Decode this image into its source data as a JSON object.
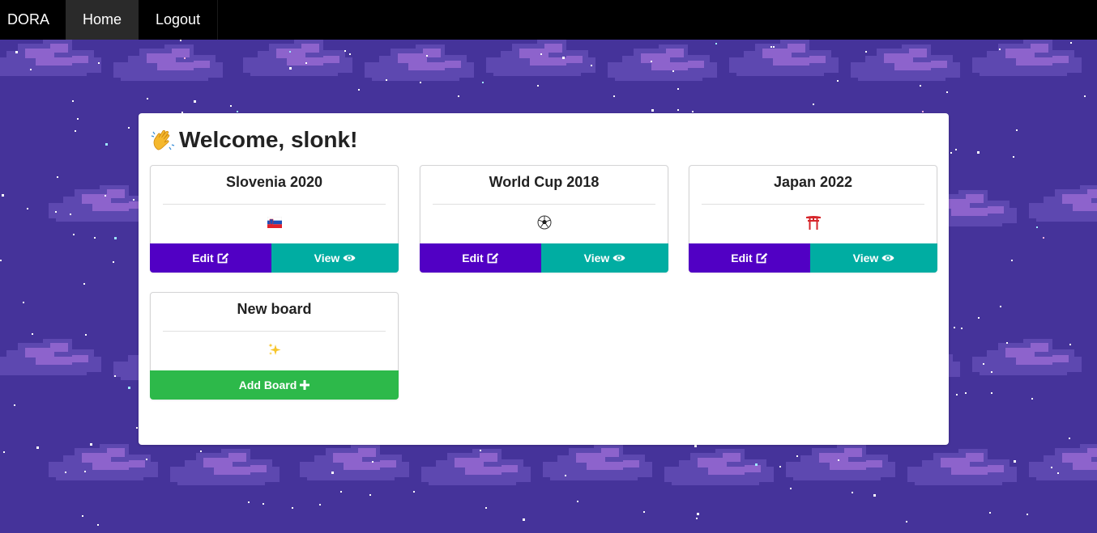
{
  "navbar": {
    "brand": "DORA",
    "items": [
      {
        "label": "Home",
        "active": true
      },
      {
        "label": "Logout",
        "active": false
      }
    ]
  },
  "welcome": {
    "icon": "waving-hand-icon",
    "text": "Welcome, slonk!"
  },
  "boards": [
    {
      "title": "Slovenia 2020",
      "icon": "slovenia-flag-icon",
      "edit_label": "Edit",
      "view_label": "View"
    },
    {
      "title": "World Cup 2018",
      "icon": "soccer-ball-icon",
      "edit_label": "Edit",
      "view_label": "View"
    },
    {
      "title": "Japan 2022",
      "icon": "torii-gate-icon",
      "edit_label": "Edit",
      "view_label": "View"
    }
  ],
  "new_board": {
    "title": "New board",
    "icon": "sparkles-icon",
    "add_label": "Add Board"
  },
  "colors": {
    "background": "#45339a",
    "navbar": "#000000",
    "edit_button": "#5100c4",
    "view_button": "#00ada2",
    "add_button": "#2db94a"
  }
}
